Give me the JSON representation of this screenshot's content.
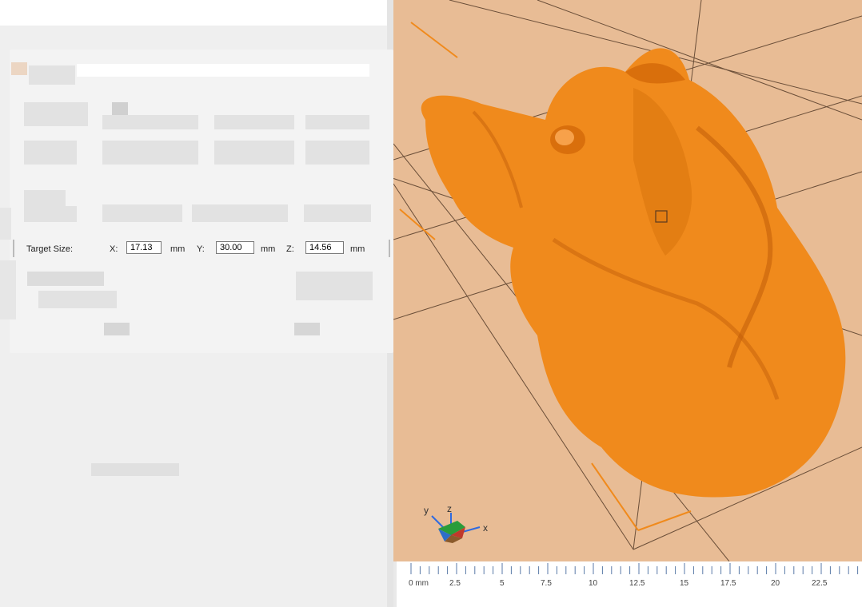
{
  "scale_dialog": {
    "target_size_label": "Target Size:",
    "x_label": "X:",
    "x_value": "17.13",
    "y_label": "Y:",
    "y_value": "30.00",
    "z_label": "Z:",
    "z_value": "14.56",
    "unit": "mm"
  },
  "axes_indicator": {
    "x_label": "x",
    "y_label": "y",
    "z_label": "z"
  },
  "ruler": {
    "unit_label": "0 mm",
    "ticks": [
      "2.5",
      "5",
      "7.5",
      "10",
      "12.5",
      "15",
      "17.5",
      "20",
      "22.5"
    ]
  },
  "colors": {
    "model": "#f08a1c",
    "bed": "#e8bc95",
    "panel": "#efefef"
  }
}
